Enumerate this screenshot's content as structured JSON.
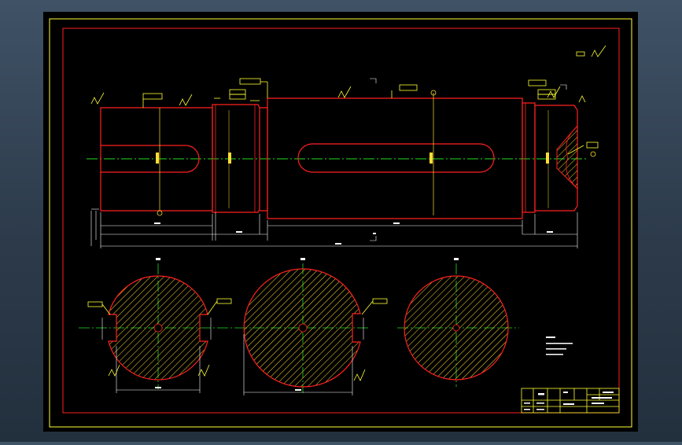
{
  "colors": {
    "background": "#000000",
    "outline": "#ff2020",
    "centerline": "#22dd22",
    "dimension": "#ffffff",
    "annotation": "#ffff00",
    "frame": "#ffff33",
    "hatch": "#ffdd33"
  },
  "title_block": {
    "part_name": "",
    "material": "",
    "scale": "",
    "drawing_no": ""
  }
}
